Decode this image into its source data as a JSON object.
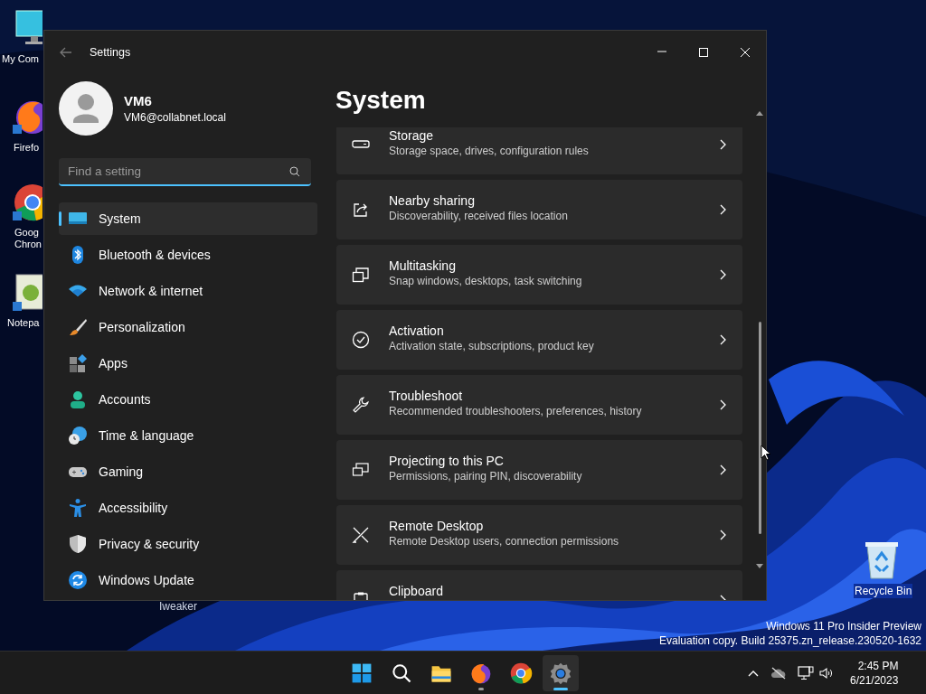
{
  "desktop_icons": [
    {
      "kind": "computer",
      "lines": [
        "My Com"
      ]
    },
    {
      "kind": "firefox",
      "lines": [
        "Firefo"
      ]
    },
    {
      "kind": "chrome",
      "lines": [
        "Goog",
        "Chron"
      ]
    },
    {
      "kind": "notepad",
      "lines": [
        "Notepa"
      ]
    }
  ],
  "desktop_label": "Iweaker",
  "recycle_bin": {
    "label": "Recycle Bin"
  },
  "window": {
    "title": "Settings",
    "user": {
      "name": "VM6",
      "email": "VM6@collabnet.local"
    },
    "search": {
      "placeholder": "Find a setting"
    },
    "nav": [
      {
        "kind": "system",
        "label": "System",
        "selected": true
      },
      {
        "kind": "bluetooth",
        "label": "Bluetooth & devices",
        "selected": false
      },
      {
        "kind": "network",
        "label": "Network & internet",
        "selected": false
      },
      {
        "kind": "personalization",
        "label": "Personalization",
        "selected": false
      },
      {
        "kind": "apps",
        "label": "Apps",
        "selected": false
      },
      {
        "kind": "accounts",
        "label": "Accounts",
        "selected": false
      },
      {
        "kind": "time",
        "label": "Time & language",
        "selected": false
      },
      {
        "kind": "gaming",
        "label": "Gaming",
        "selected": false
      },
      {
        "kind": "accessibility",
        "label": "Accessibility",
        "selected": false
      },
      {
        "kind": "privacy",
        "label": "Privacy & security",
        "selected": false
      },
      {
        "kind": "update",
        "label": "Windows Update",
        "selected": false
      }
    ],
    "heading": "System",
    "cards": [
      {
        "kind": "storage",
        "title": "Storage",
        "subtitle": "Storage space, drives, configuration rules"
      },
      {
        "kind": "share",
        "title": "Nearby sharing",
        "subtitle": "Discoverability, received files location"
      },
      {
        "kind": "multitask",
        "title": "Multitasking",
        "subtitle": "Snap windows, desktops, task switching"
      },
      {
        "kind": "activation",
        "title": "Activation",
        "subtitle": "Activation state, subscriptions, product key"
      },
      {
        "kind": "troubleshoot",
        "title": "Troubleshoot",
        "subtitle": "Recommended troubleshooters, preferences, history"
      },
      {
        "kind": "project",
        "title": "Projecting to this PC",
        "subtitle": "Permissions, pairing PIN, discoverability"
      },
      {
        "kind": "remote",
        "title": "Remote Desktop",
        "subtitle": "Remote Desktop users, connection permissions"
      },
      {
        "kind": "clipboard",
        "title": "Clipboard"
      }
    ]
  },
  "watermark": [
    "Windows 11 Pro Insider Preview",
    "Evaluation copy. Build 25375.zn_release.230520-1632"
  ],
  "taskbar": {
    "apps": [
      {
        "kind": "start",
        "running": false,
        "selected": false
      },
      {
        "kind": "search",
        "running": false,
        "selected": false
      },
      {
        "kind": "explorer",
        "running": false,
        "selected": false
      },
      {
        "kind": "firefox",
        "running": true,
        "selected": false
      },
      {
        "kind": "chrome",
        "running": false,
        "selected": false
      },
      {
        "kind": "settings",
        "running": true,
        "selected": true
      }
    ],
    "time": "2:45 PM",
    "date": "6/21/2023"
  }
}
